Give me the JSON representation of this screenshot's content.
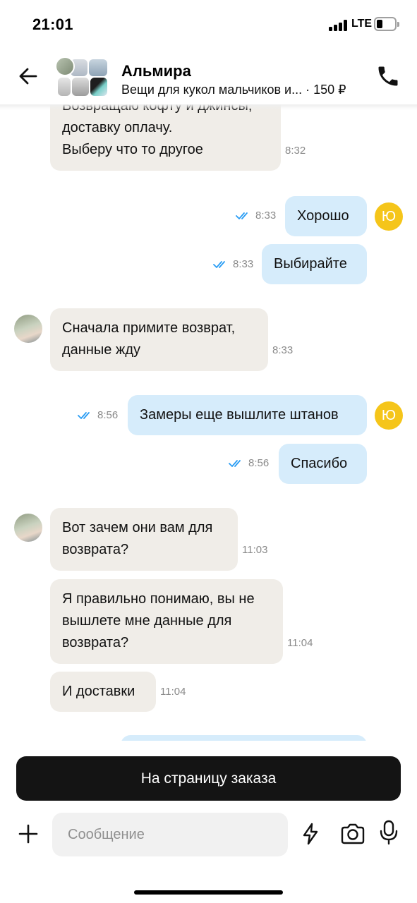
{
  "status_bar": {
    "time": "21:01",
    "network": "LTE"
  },
  "header": {
    "contact_name": "Альмира",
    "listing_title": "Вещи для кукол мальчиков и...",
    "listing_price": "· 150 ₽"
  },
  "messages": [
    {
      "direction": "in",
      "lines": [
        "Возвращаю кофту и джинсы,",
        "доставку оплачу.",
        "Выберу что то другое"
      ],
      "time": "8:32"
    },
    {
      "direction": "out",
      "lines": [
        "Хорошо"
      ],
      "time": "8:33",
      "read": true,
      "avatar_letter": "Ю"
    },
    {
      "direction": "out",
      "lines": [
        "Выбирайте"
      ],
      "time": "8:33",
      "read": true
    },
    {
      "direction": "in",
      "lines": [
        "Сначала примите возврат,",
        "данные жду"
      ],
      "time": "8:33"
    },
    {
      "direction": "out",
      "lines": [
        "Замеры еще вышлите штанов"
      ],
      "time": "8:56",
      "read": true,
      "avatar_letter": "Ю"
    },
    {
      "direction": "out",
      "lines": [
        "Спасибо"
      ],
      "time": "8:56",
      "read": true
    },
    {
      "direction": "in",
      "lines": [
        "Вот зачем они вам для",
        "возврата?"
      ],
      "time": "11:03"
    },
    {
      "direction": "in",
      "lines": [
        "Я правильно понимаю, вы не",
        "вышлете мне данные для",
        "возврата?"
      ],
      "time": "11:04"
    },
    {
      "direction": "in",
      "lines": [
        "И доставки"
      ],
      "time": "11:04"
    }
  ],
  "order_button": {
    "label": "На страницу заказа"
  },
  "composer": {
    "placeholder": "Сообщение"
  },
  "colors": {
    "incoming_bubble": "#f0ede8",
    "outgoing_bubble": "#d6ecfb",
    "read_ticks": "#2a9df4",
    "user_avatar": "#f5c51a",
    "order_button": "#141414"
  },
  "icons": [
    "back-arrow-icon",
    "phone-icon",
    "double-check-icon",
    "plus-icon",
    "lightning-icon",
    "camera-icon",
    "microphone-icon"
  ]
}
